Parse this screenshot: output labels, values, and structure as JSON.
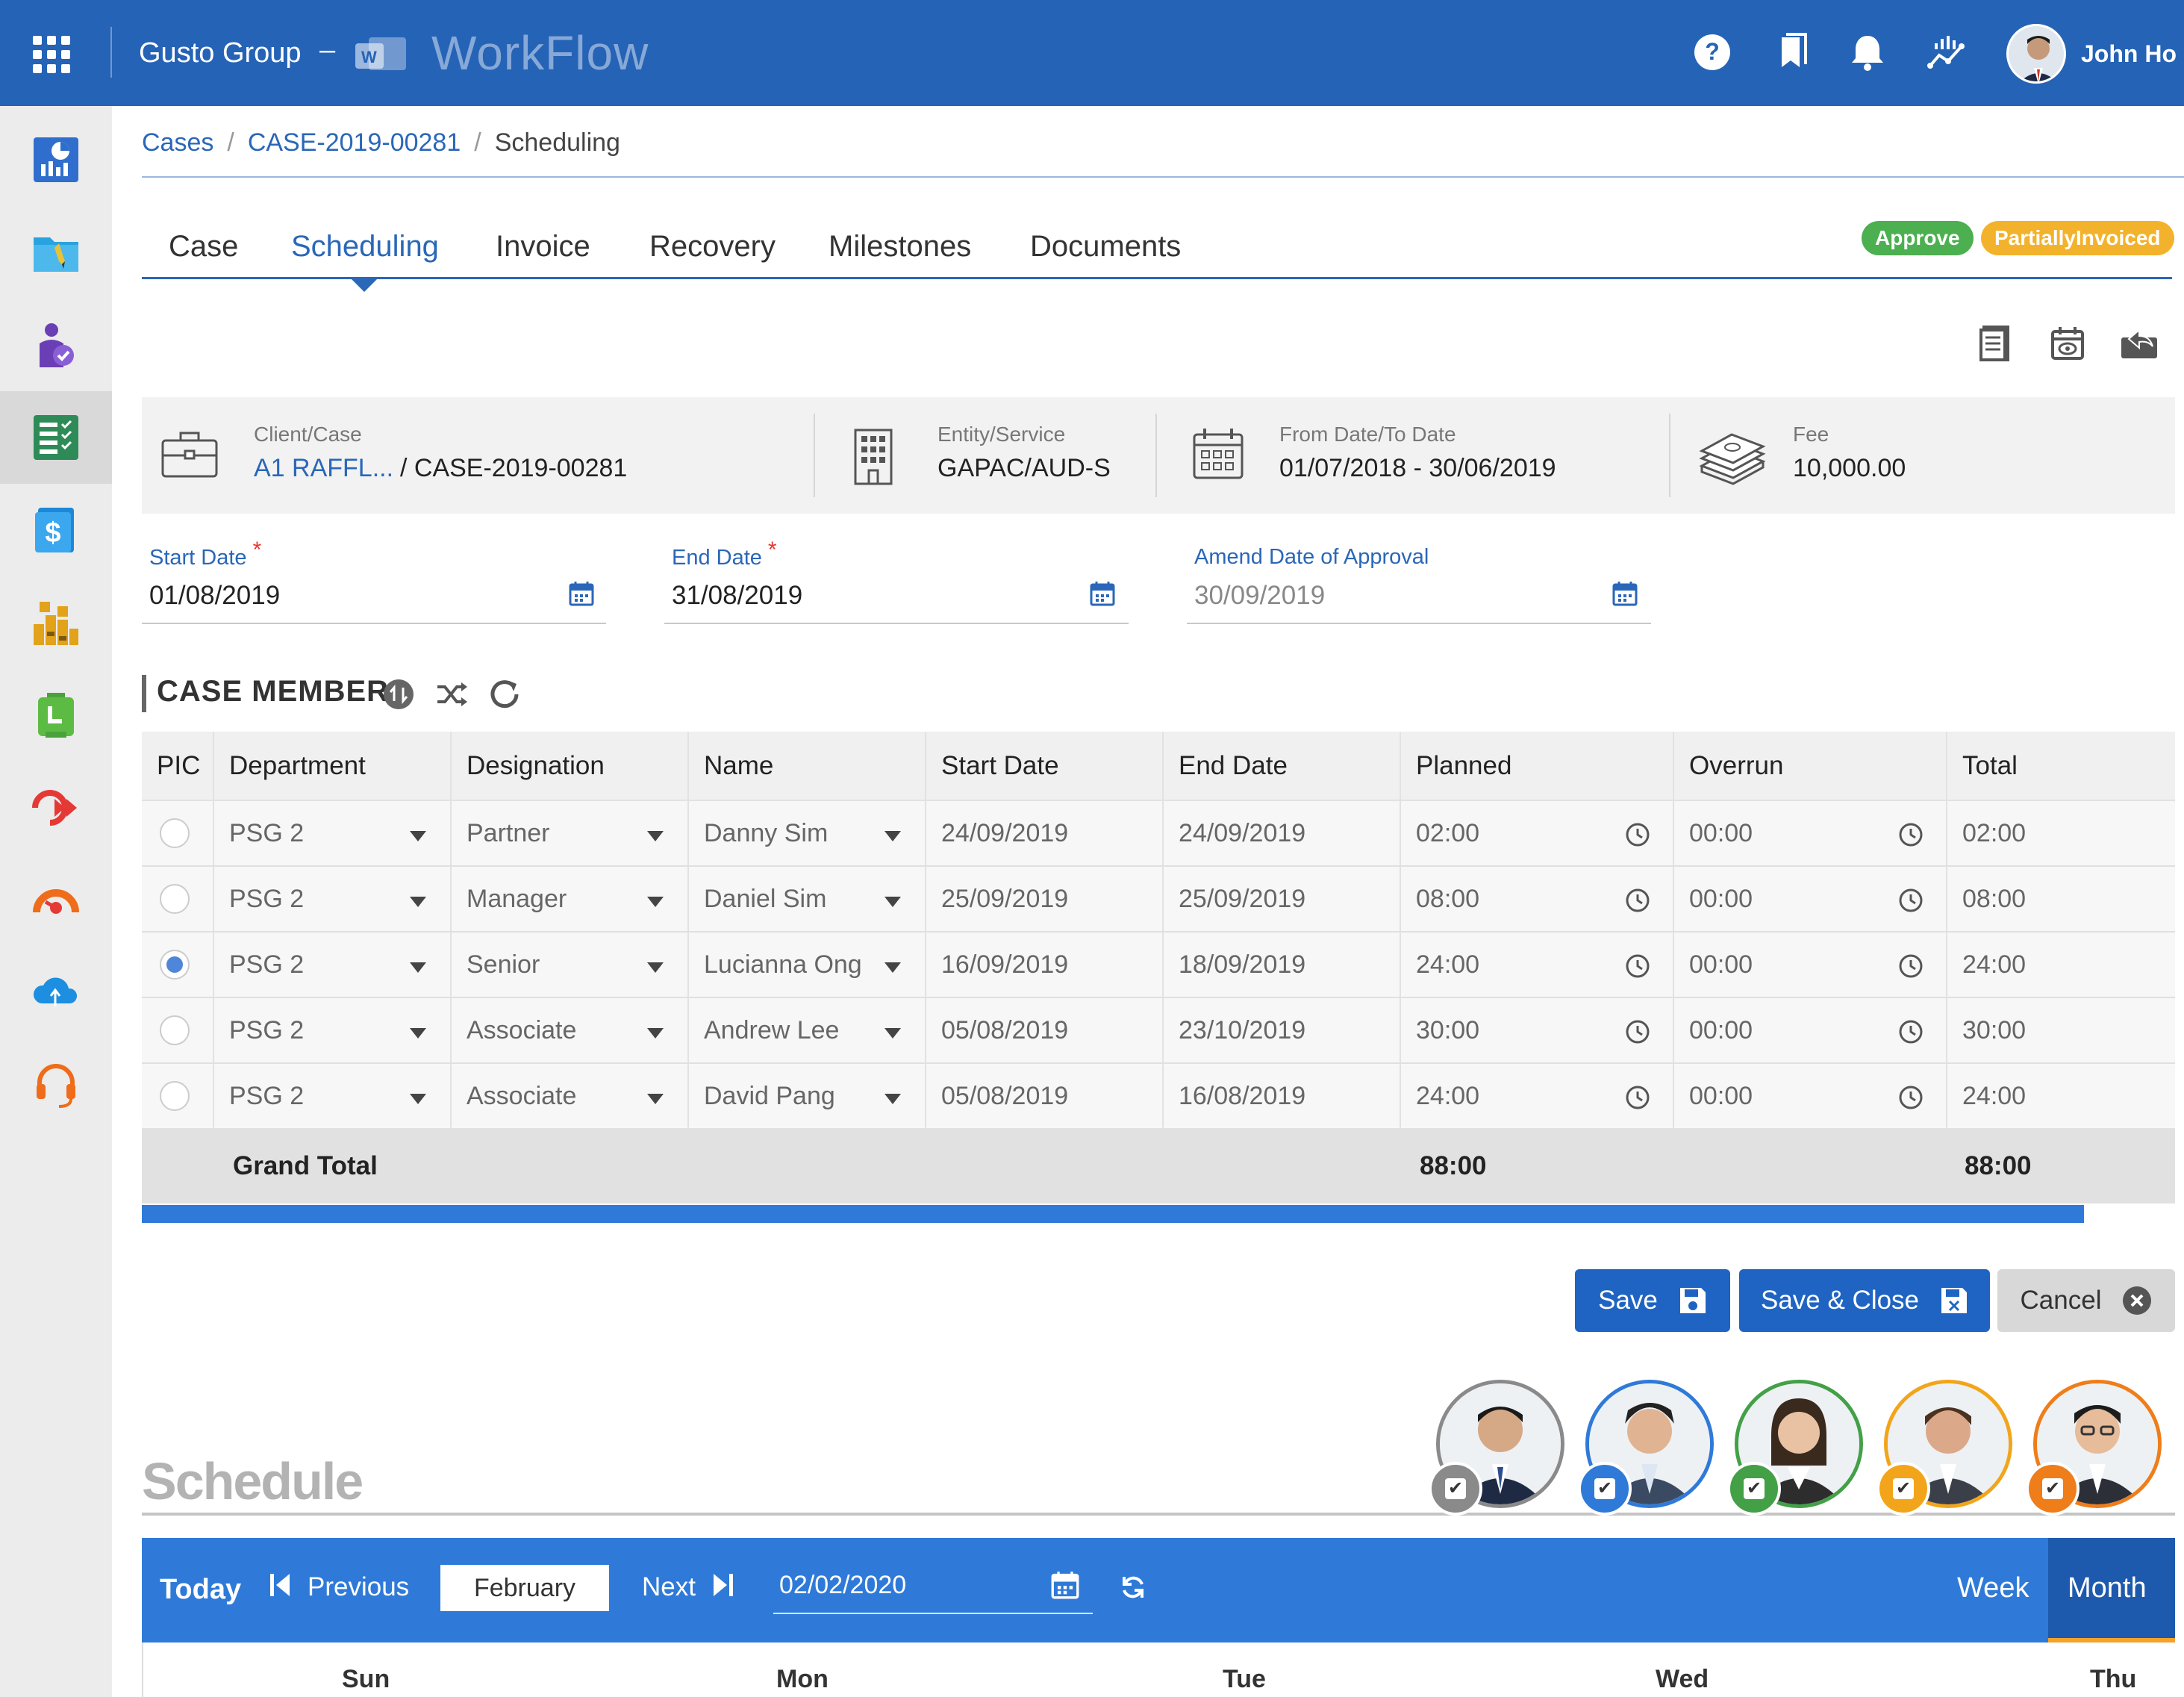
{
  "header": {
    "company": "Gusto Group",
    "separator": "–",
    "product": "WorkFlow",
    "user_name": "John Ho",
    "icons": [
      "help-icon",
      "bookmark-icon",
      "bell-icon",
      "analytics-icon"
    ]
  },
  "sidebar": {
    "items": [
      "dashboard-icon",
      "folder-icon",
      "user-check-icon",
      "spreadsheet-icon",
      "billing-icon",
      "modules-icon",
      "timesheet-icon",
      "forward-icon",
      "speedometer-icon",
      "cloud-icon",
      "support-icon"
    ],
    "active_index": 3
  },
  "breadcrumb": {
    "items": [
      "Cases",
      "CASE-2019-00281",
      "Scheduling"
    ],
    "separator": "/"
  },
  "tabs": {
    "items": [
      "Case",
      "Scheduling",
      "Invoice",
      "Recovery",
      "Milestones",
      "Documents"
    ],
    "active": "Scheduling"
  },
  "status_badges": {
    "approve": "Approve",
    "invoiced": "PartiallyInvoiced"
  },
  "info": {
    "client_label": "Client/Case",
    "client_value": "A1 RAFFL...",
    "case_value": "/ CASE-2019-00281",
    "entity_label": "Entity/Service",
    "entity_value": "GAPAC/AUD-S",
    "dates_label": "From Date/To Date",
    "dates_value": "01/07/2018 - 30/06/2019",
    "fee_label": "Fee",
    "fee_value": "10,000.00"
  },
  "form": {
    "start_label": "Start Date",
    "start_value": "01/08/2019",
    "end_label": "End Date",
    "end_value": "31/08/2019",
    "amend_label": "Amend Date of Approval",
    "amend_value": "30/09/2019",
    "required_mark": "*"
  },
  "members": {
    "title": "CASE MEMBERS",
    "columns": [
      "PIC",
      "Department",
      "Designation",
      "Name",
      "Start Date",
      "End Date",
      "Planned",
      "Overrun",
      "Total"
    ],
    "rows": [
      {
        "pic": false,
        "department": "PSG 2",
        "designation": "Partner",
        "name": "Danny Sim",
        "start": "24/09/2019",
        "end": "24/09/2019",
        "planned": "02:00",
        "overrun": "00:00",
        "total": "02:00"
      },
      {
        "pic": false,
        "department": "PSG 2",
        "designation": "Manager",
        "name": "Daniel Sim",
        "start": "25/09/2019",
        "end": "25/09/2019",
        "planned": "08:00",
        "overrun": "00:00",
        "total": "08:00"
      },
      {
        "pic": true,
        "department": "PSG 2",
        "designation": "Senior",
        "name": "Lucianna Ong",
        "start": "16/09/2019",
        "end": "18/09/2019",
        "planned": "24:00",
        "overrun": "00:00",
        "total": "24:00"
      },
      {
        "pic": false,
        "department": "PSG 2",
        "designation": "Associate",
        "name": "Andrew Lee",
        "start": "05/08/2019",
        "end": "23/10/2019",
        "planned": "30:00",
        "overrun": "00:00",
        "total": "30:00"
      },
      {
        "pic": false,
        "department": "PSG 2",
        "designation": "Associate",
        "name": "David Pang",
        "start": "05/08/2019",
        "end": "16/08/2019",
        "planned": "24:00",
        "overrun": "00:00",
        "total": "24:00"
      }
    ],
    "grand_total_label": "Grand Total",
    "grand_total_planned": "88:00",
    "grand_total_total": "88:00"
  },
  "buttons": {
    "save": "Save",
    "save_close": "Save & Close",
    "cancel": "Cancel"
  },
  "schedule": {
    "title": "Schedule",
    "avatar_colors": [
      "#8a8a8a",
      "#2f7ad8",
      "#43a047",
      "#f2a51a",
      "#ef7d1a"
    ],
    "today": "Today",
    "previous": "Previous",
    "month": "February",
    "next": "Next",
    "date": "02/02/2020",
    "week": "Week",
    "month_view": "Month",
    "days": [
      "Sun",
      "Mon",
      "Tue",
      "Wed",
      "Thu"
    ]
  },
  "colors": {
    "primary": "#2563b6",
    "accent_blue": "#2f7ad8",
    "approve_green": "#4caf50",
    "invoiced_orange": "#f3b22b"
  }
}
